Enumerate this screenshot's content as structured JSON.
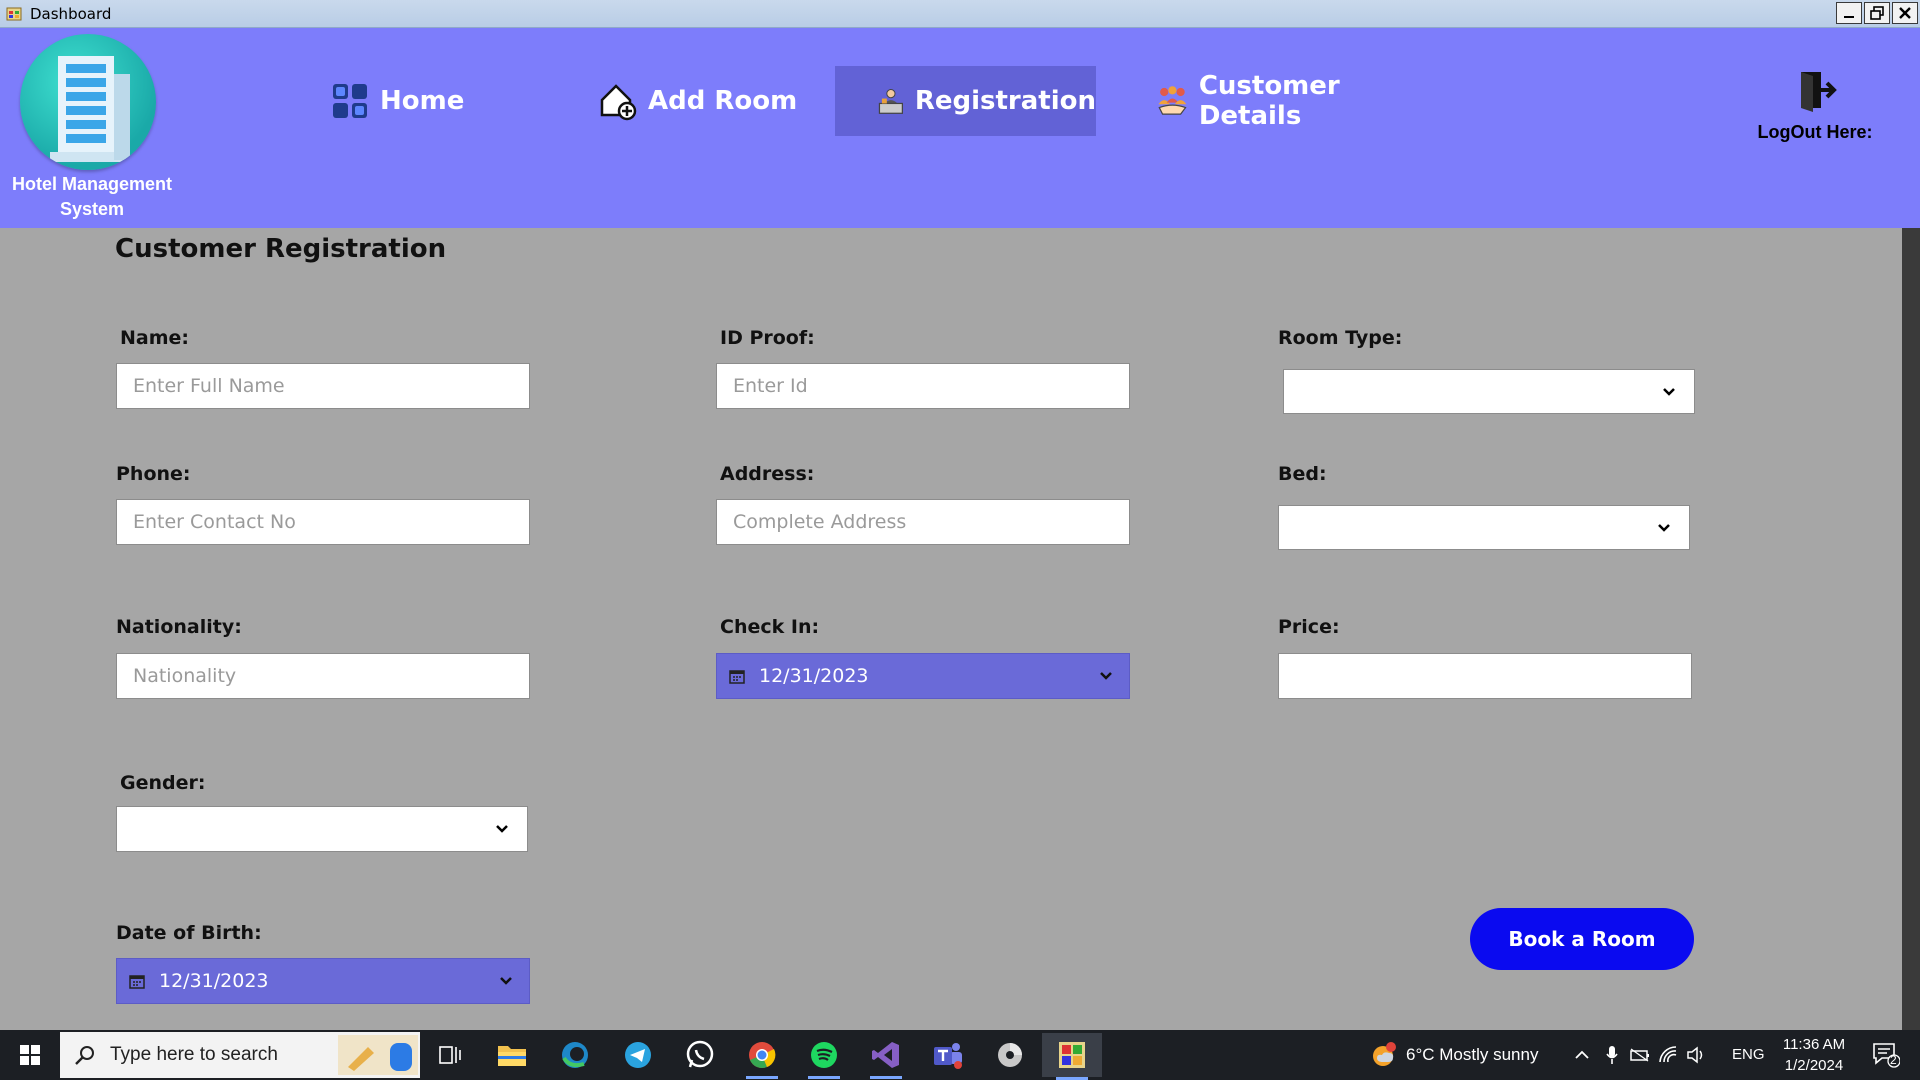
{
  "window": {
    "title": "Dashboard"
  },
  "app": {
    "name_line1": "Hotel Management",
    "name_line2": "System"
  },
  "nav": {
    "home": "Home",
    "add_room": "Add Room",
    "registration": "Registration",
    "customer_details": "Customer Details",
    "logout": "LogOut Here:"
  },
  "form": {
    "title": "Customer Registration",
    "name": {
      "label": "Name:",
      "placeholder": "Enter Full Name"
    },
    "id_proof": {
      "label": "ID Proof:",
      "placeholder": "Enter Id"
    },
    "room_type": {
      "label": "Room Type:",
      "value": ""
    },
    "phone": {
      "label": "Phone:",
      "placeholder": "Enter Contact No"
    },
    "address": {
      "label": "Address:",
      "placeholder": "Complete Address"
    },
    "bed": {
      "label": "Bed:",
      "value": ""
    },
    "nationality": {
      "label": "Nationality:",
      "placeholder": "Nationality"
    },
    "check_in": {
      "label": "Check In:",
      "value": "12/31/2023"
    },
    "price": {
      "label": "Price:",
      "value": ""
    },
    "gender": {
      "label": "Gender:",
      "value": ""
    },
    "dob": {
      "label": "Date of Birth:",
      "value": "12/31/2023"
    },
    "book_button": "Book a Room"
  },
  "taskbar": {
    "search_placeholder": "Type here to search",
    "weather": "6°C  Mostly sunny",
    "language": "ENG",
    "time": "11:36 AM",
    "date": "1/2/2024",
    "notifications": "2"
  },
  "colors": {
    "nav_bg": "#7d7dfb",
    "nav_active": "#6262d6",
    "panel_bg": "#a6a6a6",
    "date_field": "#6a6ad8",
    "book_button": "#0a0af0"
  }
}
